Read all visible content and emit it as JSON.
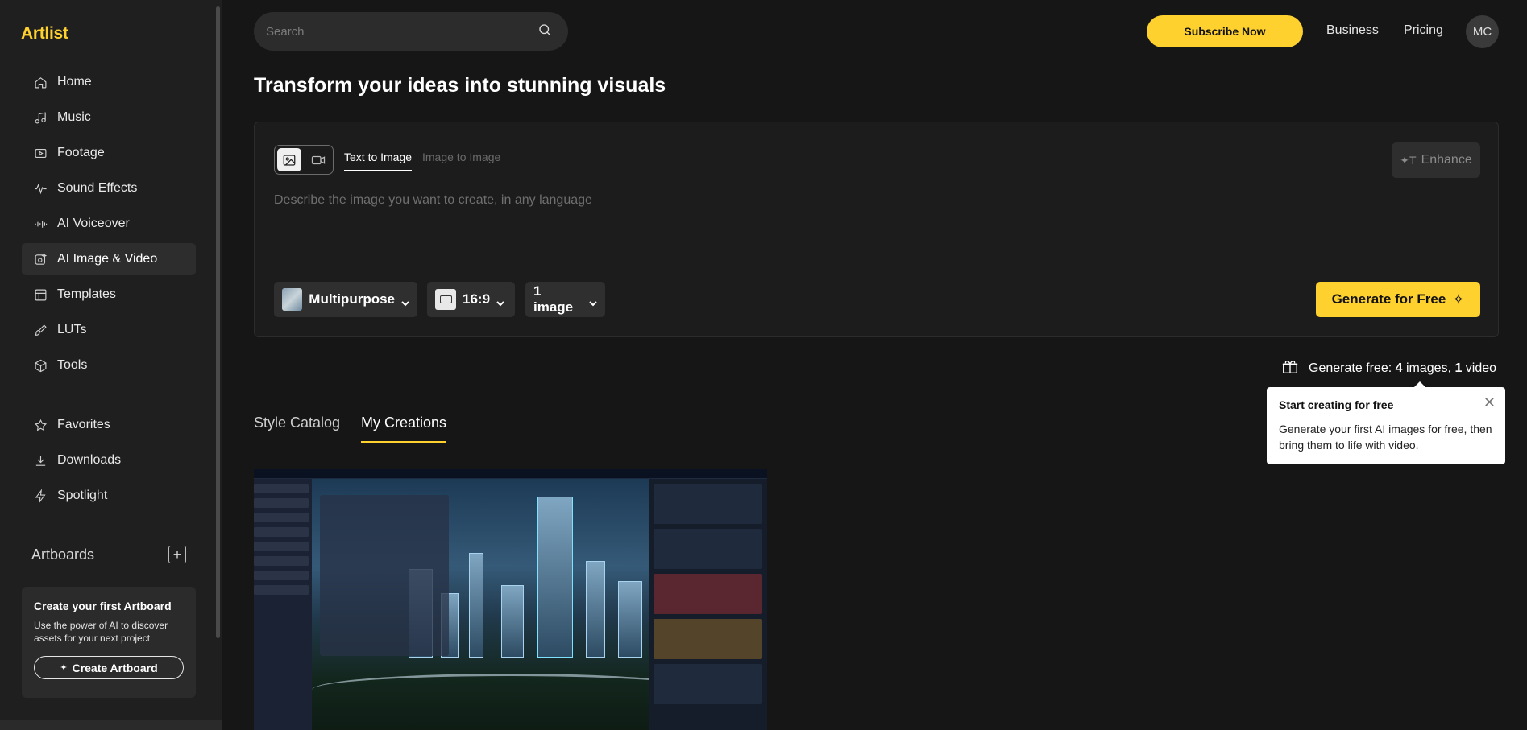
{
  "logo": "Artlist",
  "sidebar": {
    "items": [
      {
        "label": "Home",
        "icon": "home-icon"
      },
      {
        "label": "Music",
        "icon": "music-icon"
      },
      {
        "label": "Footage",
        "icon": "footage-icon"
      },
      {
        "label": "Sound Effects",
        "icon": "waveform-icon"
      },
      {
        "label": "AI Voiceover",
        "icon": "voice-icon"
      },
      {
        "label": "AI Image & Video",
        "icon": "ai-image-icon",
        "active": true
      },
      {
        "label": "Templates",
        "icon": "templates-icon"
      },
      {
        "label": "LUTs",
        "icon": "brush-icon"
      },
      {
        "label": "Tools",
        "icon": "cube-icon"
      }
    ],
    "secondary": [
      {
        "label": "Favorites",
        "icon": "star-icon"
      },
      {
        "label": "Downloads",
        "icon": "download-icon"
      },
      {
        "label": "Spotlight",
        "icon": "bolt-icon"
      }
    ],
    "artboards_label": "Artboards",
    "artboard_card": {
      "title": "Create your first Artboard",
      "text": "Use the power of AI to discover assets for your next project",
      "button": "Create Artboard"
    }
  },
  "header": {
    "search_placeholder": "Search",
    "subscribe": "Subscribe Now",
    "business": "Business",
    "pricing": "Pricing",
    "avatar": "MC"
  },
  "main": {
    "headline": "Transform your ideas into stunning visuals",
    "tabs": {
      "text_to_image": "Text to Image",
      "image_to_image": "Image to Image"
    },
    "enhance": "Enhance",
    "prompt_placeholder": "Describe the image you want to create, in any language",
    "model": "Multipurpose",
    "ratio": "16:9",
    "count": "1 image",
    "generate": "Generate for Free",
    "free_prefix": "Generate free: ",
    "free_images_num": "4",
    "free_images_word": " images, ",
    "free_video_num": "1",
    "free_video_word": " video",
    "tooltip": {
      "title": "Start creating for free",
      "text": "Generate your first AI images for free, then bring them to life with video."
    },
    "content_tabs": {
      "style_catalog": "Style Catalog",
      "my_creations": "My Creations"
    }
  },
  "colors": {
    "accent": "#ffd12e",
    "background": "#161616",
    "sidebar": "#1f1f1f"
  }
}
